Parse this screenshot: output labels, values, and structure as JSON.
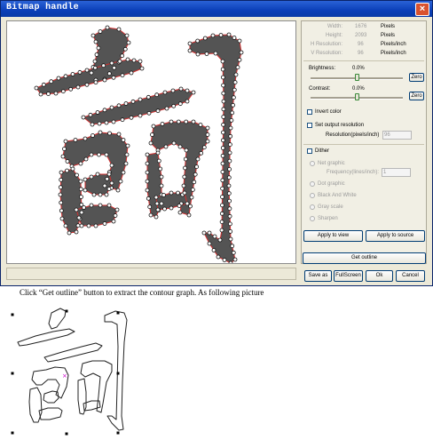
{
  "window": {
    "title": "Bitmap handle",
    "close_glyph": "×"
  },
  "info": {
    "width": {
      "label": "Width:",
      "value": "1676",
      "unit": "Pixels"
    },
    "height": {
      "label": "Height:",
      "value": "2093",
      "unit": "Pixels"
    },
    "hres": {
      "label": "H Resolution:",
      "value": "96",
      "unit": "Pixels/inch"
    },
    "vres": {
      "label": "V Resolution:",
      "value": "96",
      "unit": "Pixels/inch"
    }
  },
  "brightness": {
    "label": "Brightness:",
    "value": "0.0%",
    "zero_label": "Zero",
    "level": 0.5
  },
  "contrast": {
    "label": "Contrast:",
    "value": "0.0%",
    "zero_label": "Zero",
    "level": 0.5
  },
  "invert_color": {
    "label": "Invert color",
    "checked": false
  },
  "set_output_resolution": {
    "label": "Set output resolution",
    "checked": false
  },
  "resolution_field": {
    "label": "Resolution(pixels/inch)",
    "value": "96"
  },
  "dither": {
    "label": "Dither",
    "checked": false,
    "net_graphic": "Net graphic",
    "frequency_label": "Frequency(lines/inch):",
    "frequency_value": "1",
    "dot_graphic": "Dot graphic",
    "black_and_white": "Black And White",
    "gray_scale": "Gray scale",
    "sharpen": "Sharpen"
  },
  "buttons": {
    "apply_to_view": "Apply to view",
    "apply_to_source": "Apply to source",
    "get_outline": "Get outline",
    "save_as": "Save as",
    "fullscreen": "FullScreen",
    "ok": "Ok",
    "cancel": "Cancel"
  },
  "caption": "Click “Get outline” button to extract the contour graph. As following picture",
  "colors": {
    "titlebar": "#0b3fb8",
    "glyph_fill": "#545454",
    "outline_red": "#d03030",
    "vertex_fill": "#ffffff",
    "selection_marker": "#cc00cc"
  },
  "icons": {
    "close": "close-icon",
    "selection": "selection-handle-icon",
    "marker": "cross-marker-icon"
  }
}
